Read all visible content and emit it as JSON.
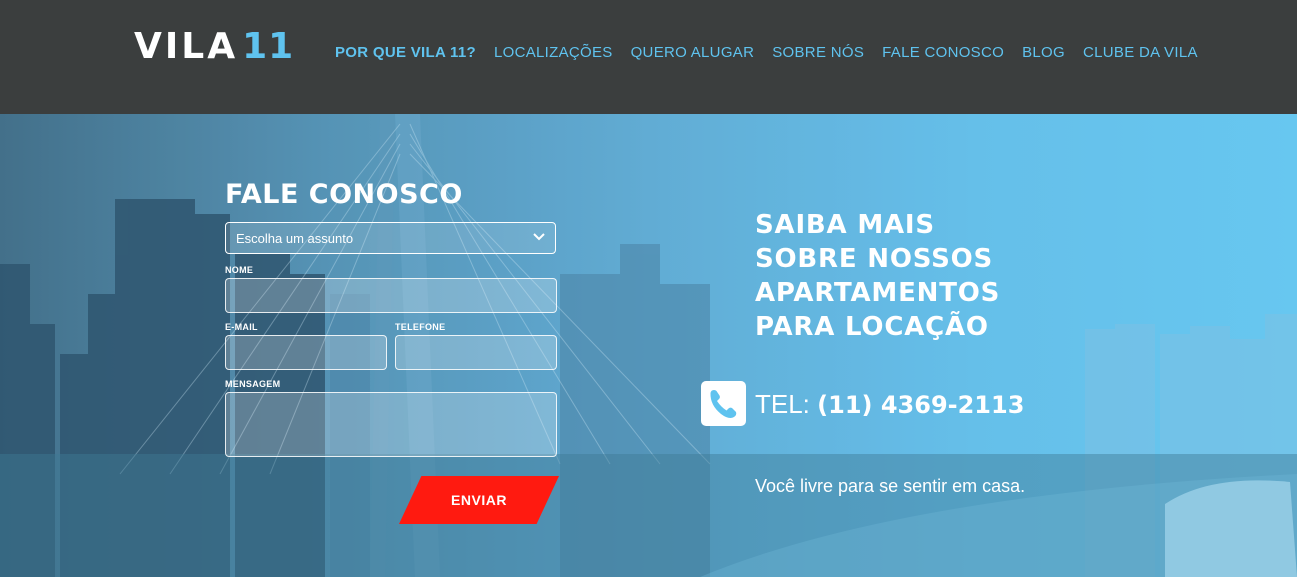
{
  "brand": {
    "word": "VILA",
    "number": "11"
  },
  "nav": {
    "items": [
      {
        "label": "POR QUE VILA 11?"
      },
      {
        "label": "LOCALIZAÇÕES"
      },
      {
        "label": "QUERO ALUGAR"
      },
      {
        "label": "SOBRE NÓS"
      },
      {
        "label": "FALE CONOSCO"
      },
      {
        "label": "BLOG"
      },
      {
        "label": "CLUBE DA VILA"
      }
    ]
  },
  "form": {
    "title": "FALE CONOSCO",
    "subject_selected": "Escolha um assunto",
    "labels": {
      "name": "NOME",
      "email": "E-MAIL",
      "phone": "TELEFONE",
      "message": "MENSAGEM"
    },
    "submit": "ENVIAR"
  },
  "promo": {
    "headline": [
      "SAIBA MAIS",
      "SOBRE NOSSOS",
      "APARTAMENTOS",
      "PARA LOCAÇÃO"
    ],
    "tel_prefix": "TEL:",
    "tel_number": "(11) 4369-2113",
    "tagline": "Você livre para se sentir em casa."
  },
  "icons": {
    "phone": "phone-icon",
    "chevron": "chevron-down-icon"
  },
  "colors": {
    "accent": "#5fc3ef",
    "button": "#ff1a10",
    "topbar": "#3b3e3e"
  }
}
